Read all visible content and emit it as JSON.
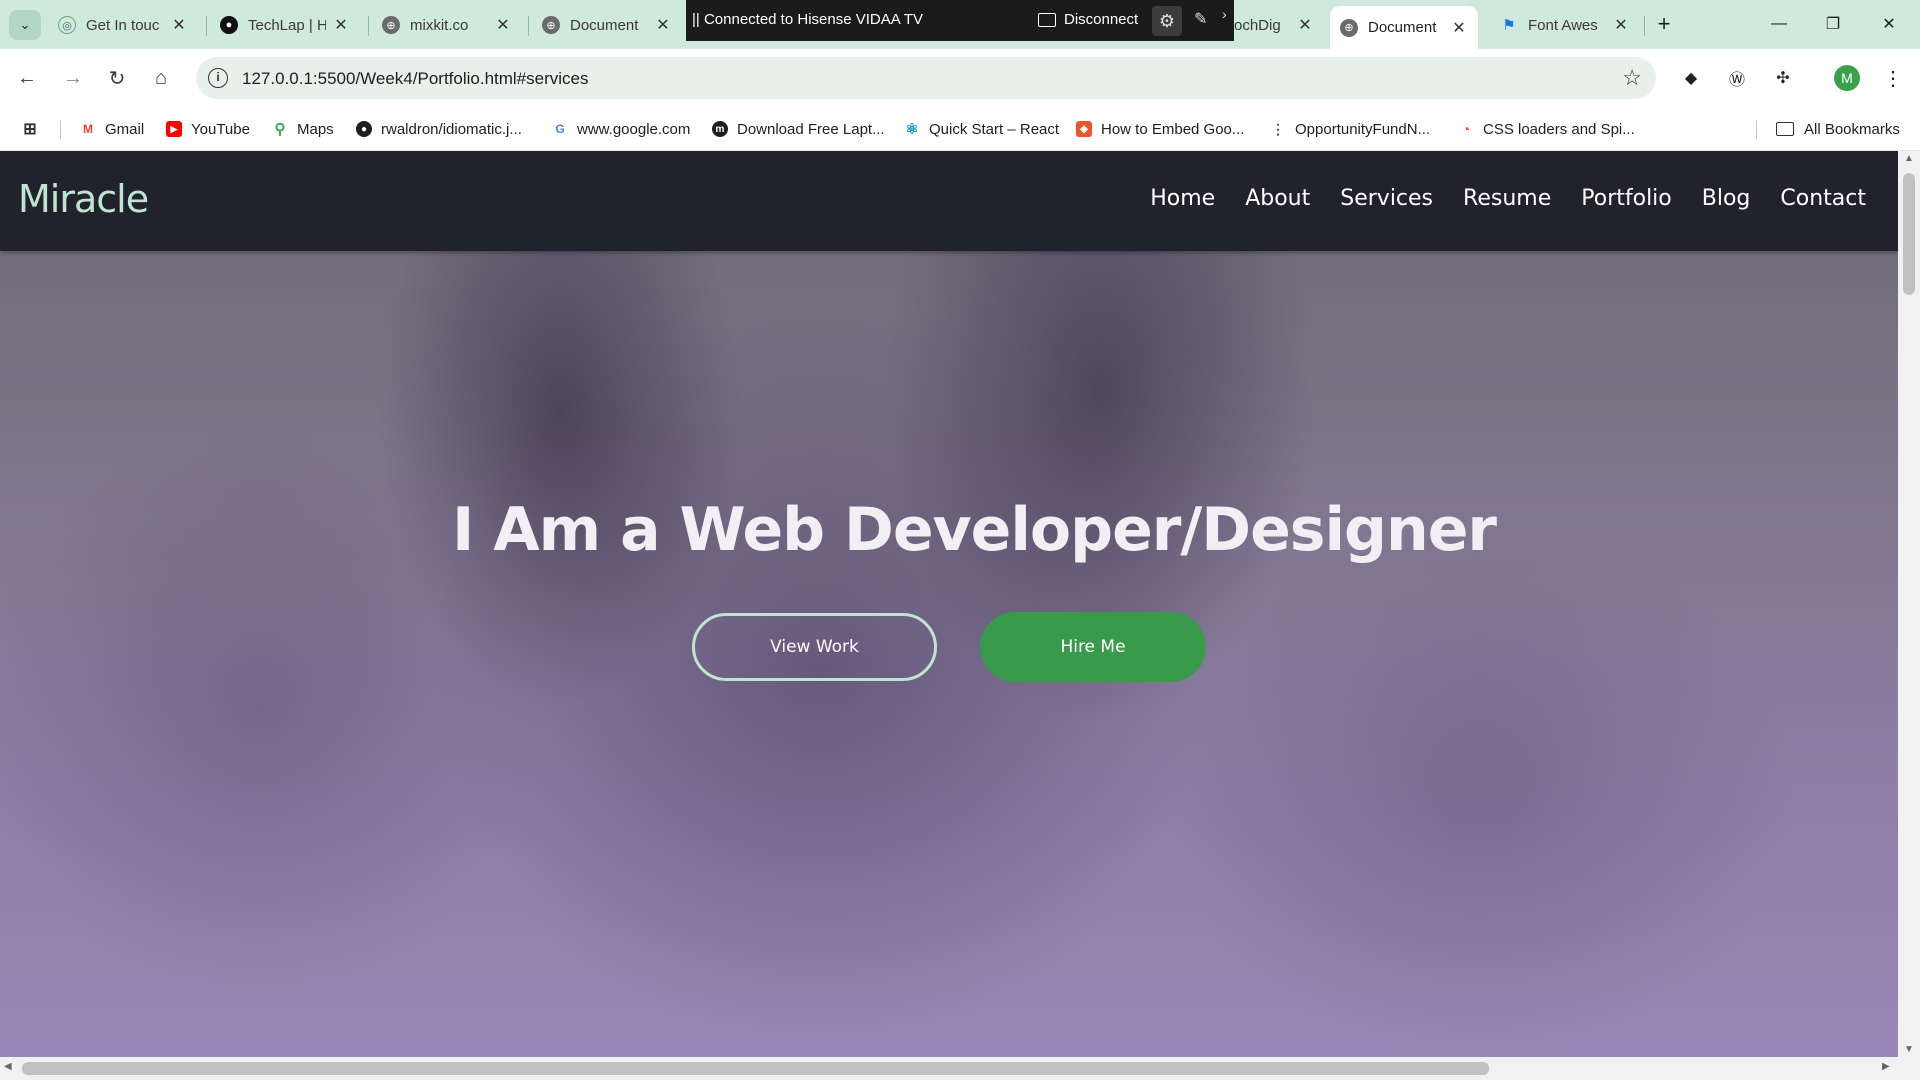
{
  "browser": {
    "tabs": [
      {
        "title": "Get In touc",
        "favicon": "globe-icon"
      },
      {
        "title": "TechLap | H",
        "favicon": "techlap-icon"
      },
      {
        "title": "mixkit.co",
        "favicon": "globe-icon"
      },
      {
        "title": "Document",
        "favicon": "globe-icon"
      },
      {
        "title": "ochDig",
        "favicon": "none"
      },
      {
        "title": "Document",
        "favicon": "globe-icon",
        "active": true
      },
      {
        "title": "Font Awes",
        "favicon": "flag-icon"
      }
    ],
    "close_glyph": "✕",
    "new_tab_glyph": "+",
    "cast": {
      "label": "|| Connected to Hisense VIDAA TV",
      "disconnect": "Disconnect"
    },
    "url": "127.0.0.1:5500/Week4/Portfolio.html#services",
    "avatar_letter": "M",
    "bookmarks": [
      {
        "label": "Gmail",
        "icon": "gmail-icon",
        "color": "#ea4335"
      },
      {
        "label": "YouTube",
        "icon": "youtube-icon",
        "color": "#ff0000"
      },
      {
        "label": "Maps",
        "icon": "maps-icon",
        "color": "#34a853"
      },
      {
        "label": "rwaldron/idiomatic.j...",
        "icon": "github-icon",
        "color": "#1f1f1f"
      },
      {
        "label": "www.google.com",
        "icon": "google-icon",
        "color": "#4285f4"
      },
      {
        "label": "Download Free Lapt...",
        "icon": "m-icon",
        "color": "#1f1f1f"
      },
      {
        "label": "Quick Start – React",
        "icon": "react-icon",
        "color": "#149eca"
      },
      {
        "label": "How to Embed Goo...",
        "icon": "embed-icon",
        "color": "#e8572a"
      },
      {
        "label": "OpportunityFundN...",
        "icon": "dots-icon",
        "color": "#555555"
      },
      {
        "label": "CSS loaders and Spi...",
        "icon": "loader-icon",
        "color": "#e8572a"
      }
    ],
    "all_bookmarks": "All Bookmarks"
  },
  "site": {
    "logo": "Miracle",
    "nav": [
      "Home",
      "About",
      "Services",
      "Resume",
      "Portfolio",
      "Blog",
      "Contact"
    ],
    "hero_title": "I Am a Web Developer/Designer",
    "btn_view": "View Work",
    "btn_hire": "Hire Me"
  },
  "colors": {
    "nav_bg": "#22222c",
    "logo": "#bfe4cf",
    "hire_button": "#3a9a4c",
    "tabstrip": "#cfe9dc"
  }
}
